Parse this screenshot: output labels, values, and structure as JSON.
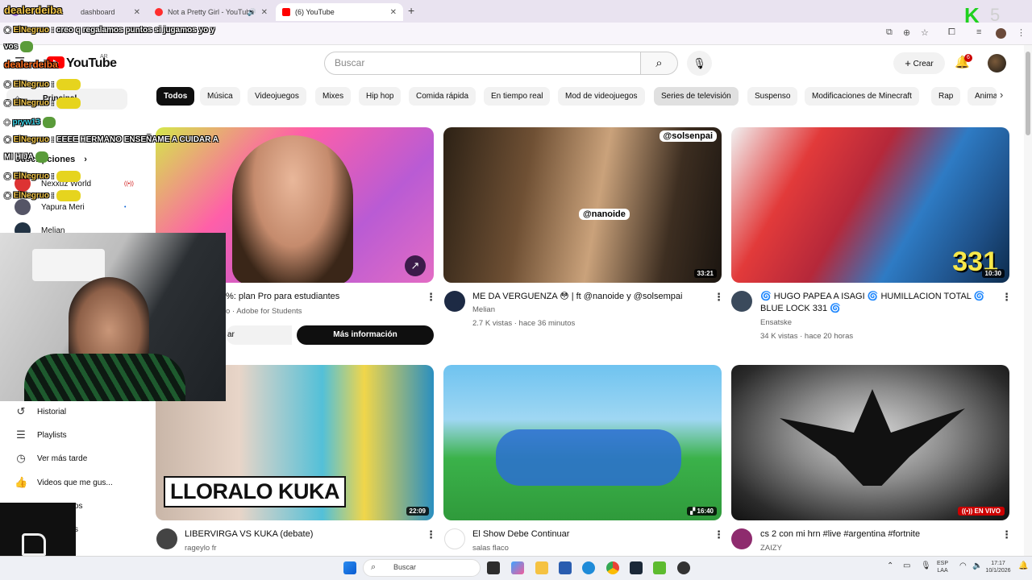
{
  "browser": {
    "tabs": [
      {
        "label": "dashboard",
        "close": "✕"
      },
      {
        "label": "Not a Pretty Girl - YouTube",
        "close": "✕"
      },
      {
        "label": "(6) YouTube",
        "close": "✕"
      }
    ],
    "new_tab": "+"
  },
  "overlay": {
    "stream_logo": "K",
    "stream_logo_num": "5",
    "chat": [
      {
        "name": "ElNegruo",
        "text": ": creo q regalamos puntos si jugamos yo y"
      },
      {
        "name": "",
        "text": "vos"
      },
      {
        "name": "dealerdeiba",
        "text": ""
      },
      {
        "name": "ElNegruo",
        "text": ":"
      },
      {
        "name": "ElNegruo",
        "text": ":"
      },
      {
        "name": "pryw13",
        "text": ""
      },
      {
        "name": "ElNegruo",
        "text": ": EEEE HERMANO ENSEÑAME A CUIDAR A"
      },
      {
        "name": "",
        "text": "MI HIJA"
      },
      {
        "name": "ElNegruo",
        "text": ":"
      },
      {
        "name": "ElNegruo",
        "text": ":"
      }
    ],
    "top_handle": "dealerdeiba"
  },
  "youtube": {
    "logo": "YouTube",
    "country": "AR",
    "search_placeholder": "Buscar",
    "create_label": "Crear",
    "notif_count": "6",
    "chips": [
      "Todos",
      "Música",
      "Videojuegos",
      "Mixes",
      "Hip hop",
      "Comida rápida",
      "En tiempo real",
      "Mod de videojuegos",
      "Series de televisión",
      "Suspenso",
      "Modificaciones de Minecraft",
      "Rap",
      "Anima"
    ],
    "sidebar": {
      "main_label": "Principal",
      "subs_label": "Suscripciones",
      "subs": [
        {
          "name": "Nexxuz World",
          "badge": "((•))"
        },
        {
          "name": "Yapura Meri",
          "badge": "•"
        },
        {
          "name": "Melian",
          "badge": ""
        }
      ],
      "you_items": [
        {
          "label": "Historial"
        },
        {
          "label": "Playlists"
        },
        {
          "label": "Ver más tarde"
        },
        {
          "label": "Videos que me gus..."
        }
      ],
      "partial": [
        "os",
        "s"
      ]
    },
    "ad": {
      "title": "%: plan Pro para estudiantes",
      "sponsor": "o · Adobe for Students",
      "secondary_btn": "ar",
      "cta": "Más información"
    },
    "videos": [
      {
        "title": "ME DA VERGUENZA 😳 | ft @nanoide  y @solsempai",
        "channel": "Melian",
        "meta": "2.7 K vistas · hace 36 minutos",
        "duration": "33:21",
        "tag1": "@solsenpai",
        "tag2": "@nanoide"
      },
      {
        "title": "🌀 HUGO PAPEA A ISAGI 🌀 HUMILLACION TOTAL 🌀 BLUE LOCK 331 🌀",
        "channel": "Ensatske",
        "meta": "34 K vistas · hace 20 horas",
        "duration": "10:30",
        "tag1": "331"
      },
      {
        "title": "LIBERVIRGA VS KUKA (debate)",
        "channel": "rageylo fr",
        "duration": "22:09",
        "overlay": "LLORALO KUKA"
      },
      {
        "title": "El Show Debe Continuar",
        "channel": "salas flaco",
        "duration": "16:40"
      },
      {
        "title": "cs 2 con mi hrn  #live #argentina #fortnite",
        "channel": "ZAIZY",
        "live": "EN VIVO"
      }
    ]
  },
  "taskbar": {
    "search": "Buscar",
    "lang1": "ESP",
    "lang2": "LAA",
    "time": "17:17",
    "date": "10/1/2026"
  }
}
